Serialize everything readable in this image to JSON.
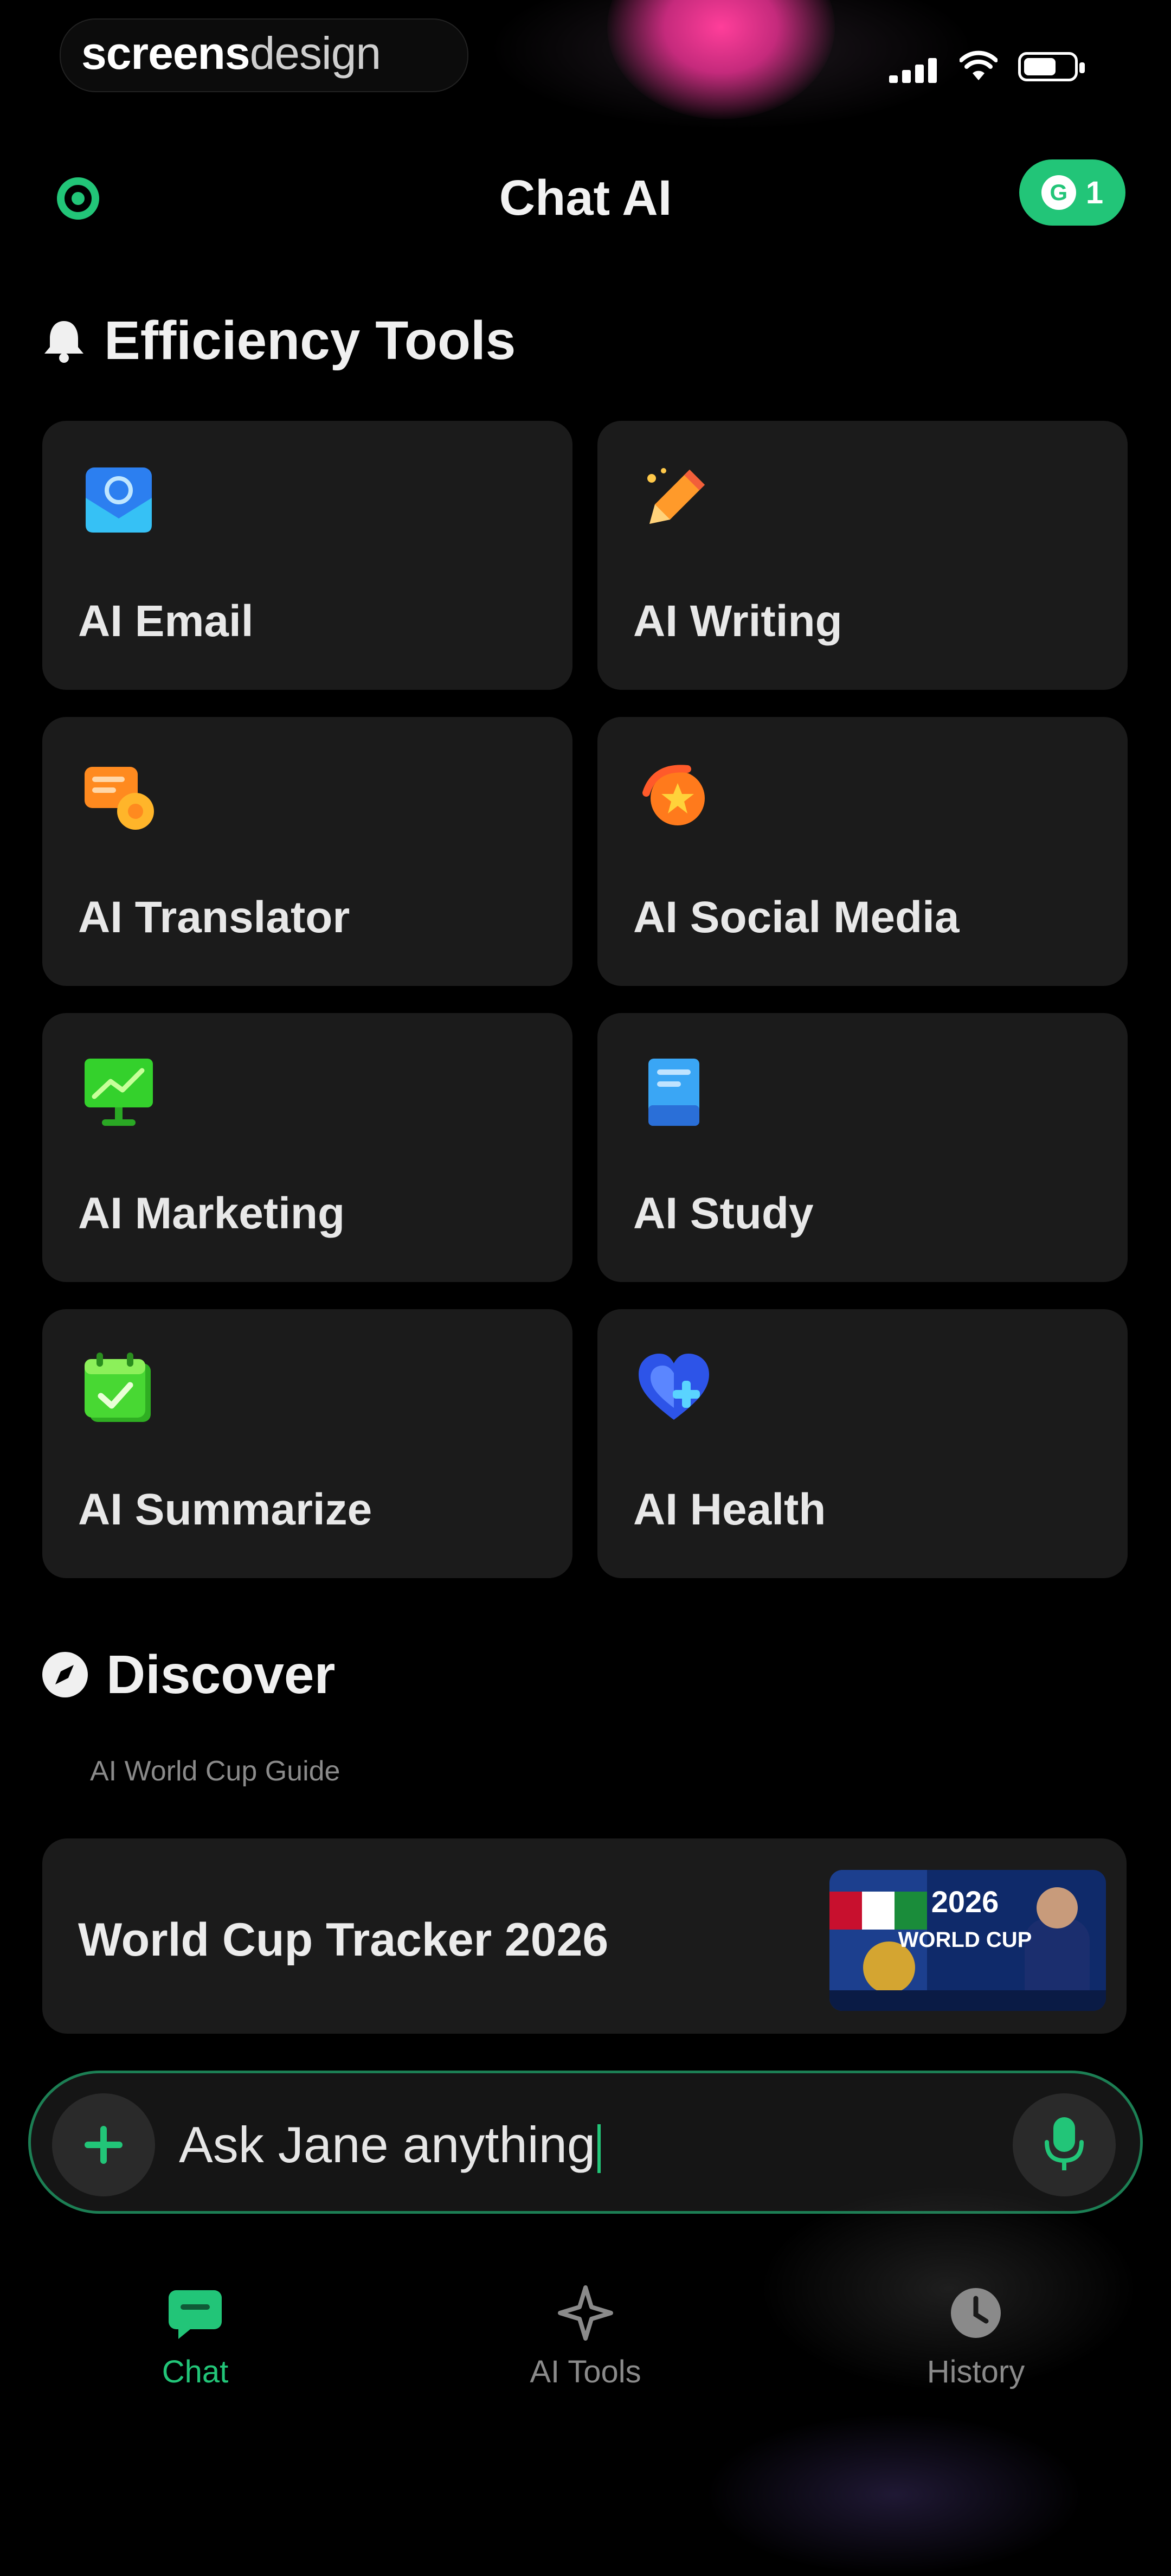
{
  "status_bar": {
    "brand_bold": "screens",
    "brand_light": "design",
    "signal_icon": "signal-icon",
    "wifi_icon": "wifi-icon",
    "battery_icon": "battery-icon"
  },
  "header": {
    "title": "Chat AI",
    "settings_icon": "settings-gear-icon",
    "coin_badge": {
      "icon": "coin-icon",
      "icon_glyph": "G",
      "count": "1"
    }
  },
  "efficiency": {
    "heading": "Efficiency Tools",
    "heading_icon": "bell-icon",
    "tools": [
      {
        "label": "AI Email",
        "icon": "email-icon"
      },
      {
        "label": "AI Writing",
        "icon": "pencil-icon"
      },
      {
        "label": "AI Translator",
        "icon": "translate-bubbles-icon"
      },
      {
        "label": "AI Social Media",
        "icon": "social-media-icon"
      },
      {
        "label": "AI Marketing",
        "icon": "marketing-chart-icon"
      },
      {
        "label": "AI Study",
        "icon": "book-icon"
      },
      {
        "label": "AI Summarize",
        "icon": "calendar-check-icon"
      },
      {
        "label": "AI Health",
        "icon": "heart-plus-icon"
      }
    ]
  },
  "discover": {
    "heading": "Discover",
    "heading_icon": "compass-icon",
    "subtitle": "AI World Cup Guide",
    "card": {
      "title": "World Cup Tracker 2026",
      "thumb_line1": "2026",
      "thumb_line2": "WORLD CUP"
    }
  },
  "composer": {
    "placeholder": "Ask Jane anything",
    "plus_icon": "plus-icon",
    "mic_icon": "microphone-icon"
  },
  "tabs": [
    {
      "label": "Chat",
      "icon": "chat-bubble-icon",
      "active": true
    },
    {
      "label": "AI Tools",
      "icon": "ai-sparkle-icon",
      "active": false
    },
    {
      "label": "History",
      "icon": "clock-icon",
      "active": false
    }
  ],
  "colors": {
    "accent": "#22c578",
    "background": "#000000",
    "card": "#1b1b1b"
  }
}
